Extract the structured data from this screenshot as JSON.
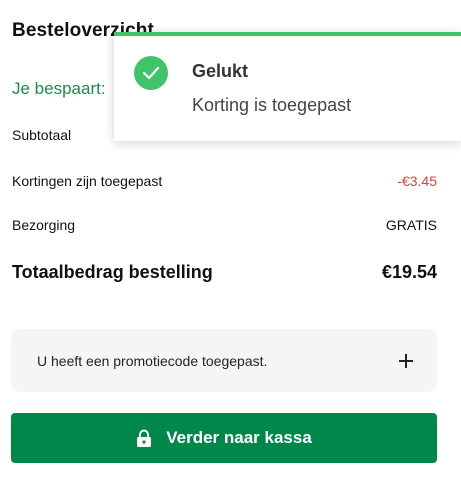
{
  "summary": {
    "title": "Besteloverzicht",
    "savings_label": "Je bespaart:",
    "rows": {
      "subtotal": {
        "label": "Subtotaal"
      },
      "discount": {
        "label": "Kortingen zijn toegepast",
        "value": "-€3.45"
      },
      "shipping": {
        "label": "Bezorging",
        "value": "GRATIS"
      },
      "total": {
        "label": "Totaalbedrag bestelling",
        "value": "€19.54"
      }
    }
  },
  "promo": {
    "text": "U heeft een promotiecode toegepast.",
    "icon": "plus-icon"
  },
  "checkout": {
    "label": "Verder naar kassa",
    "icon": "lock-icon",
    "color": "#00874a"
  },
  "toast": {
    "title": "Gelukt",
    "message": "Korting is toegepast",
    "icon": "check-icon",
    "accent": "#3fc46a"
  }
}
